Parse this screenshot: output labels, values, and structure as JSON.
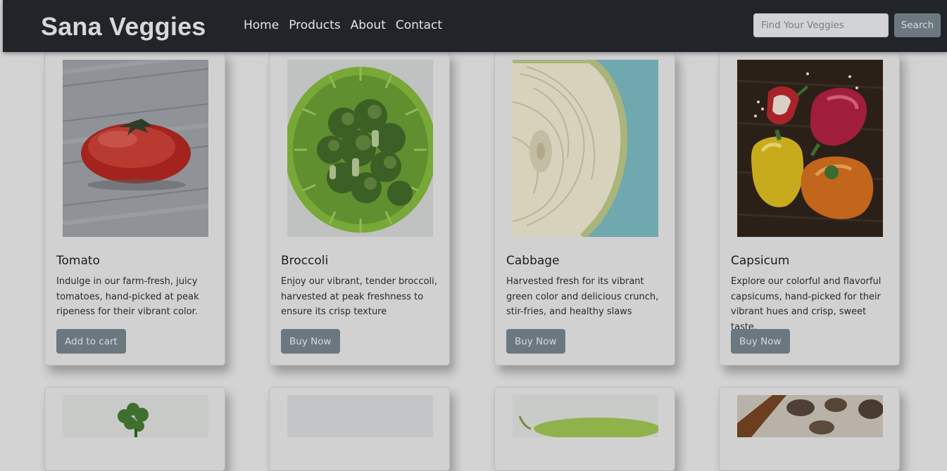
{
  "brand": "Sana Veggies",
  "nav": [
    "Home",
    "Products",
    "About",
    "Contact"
  ],
  "search": {
    "placeholder": "Find Your Veggies",
    "button_label": "Search"
  },
  "products": [
    {
      "title": "Tomato",
      "description": "Indulge in our farm-fresh, juicy tomatoes, hand-picked at peak ripeness for their vibrant color.",
      "button_label": "Add to cart"
    },
    {
      "title": "Broccoli",
      "description": "Enjoy our vibrant, tender broccoli, harvested at peak freshness to ensure its crisp texture",
      "button_label": "Buy Now"
    },
    {
      "title": "Cabbage",
      "description": "Harvested fresh for its vibrant green color and delicious crunch, stir-fries, and healthy slaws",
      "button_label": "Buy Now"
    },
    {
      "title": "Capsicum",
      "description": "Explore our colorful and flavorful capsicums, hand-picked for their vibrant hues and crisp, sweet taste.",
      "button_label": "Buy Now"
    }
  ],
  "colors": {
    "navbar": "#212529",
    "button": "#6c7880",
    "backdrop": "#d3d3d3"
  }
}
